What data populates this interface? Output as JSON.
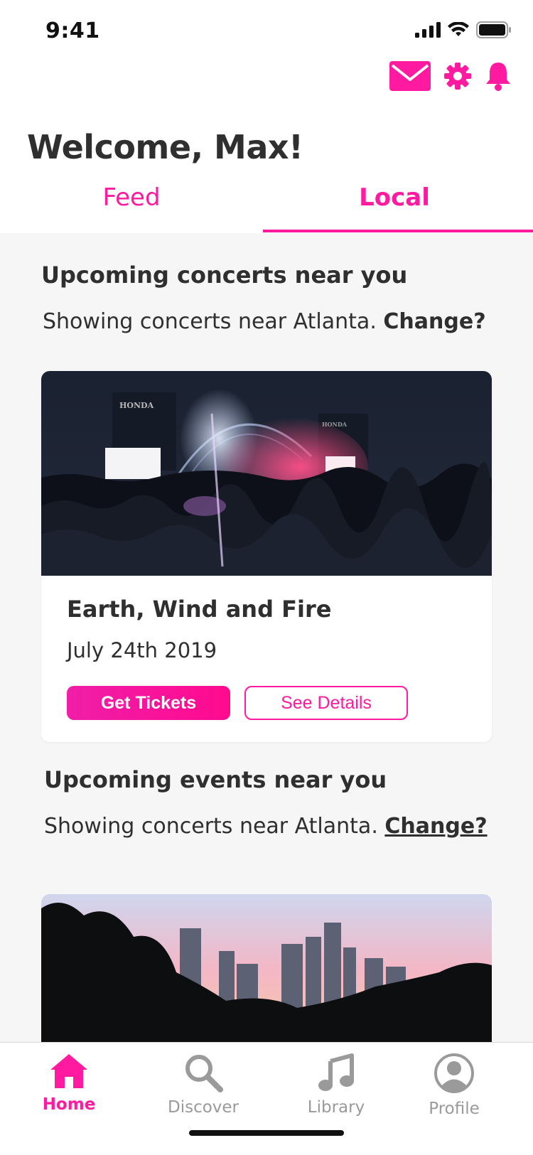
{
  "status_bar": {
    "time": "9:41"
  },
  "header": {
    "welcome": "Welcome, Max!"
  },
  "tabs": [
    {
      "label": "Feed",
      "active": false
    },
    {
      "label": "Local",
      "active": true
    }
  ],
  "sections": {
    "concerts": {
      "title": "Upcoming concerts near you",
      "subtitle_prefix": "Showing concerts near Atlanta. ",
      "change": "Change?"
    },
    "events": {
      "title": "Upcoming events near you",
      "subtitle_prefix": "Showing concerts near Atlanta. ",
      "change": "Change?"
    }
  },
  "concert_card": {
    "artist": "Earth, Wind and Fire",
    "date": "July 24th 2019",
    "primary_button": "Get Tickets",
    "secondary_button": "See Details",
    "image_brand_1": "HONDA",
    "image_brand_2": "HONDA"
  },
  "tab_bar": {
    "items": [
      {
        "label": "Home",
        "icon": "home-icon",
        "active": true
      },
      {
        "label": "Discover",
        "icon": "search-icon",
        "active": false
      },
      {
        "label": "Library",
        "icon": "music-note-icon",
        "active": false
      },
      {
        "label": "Profile",
        "icon": "profile-icon",
        "active": false
      }
    ]
  },
  "colors": {
    "accent": "#ff1aa0",
    "text": "#2f2f2f",
    "inactive": "#9a9a9a",
    "background": "#f6f6f7"
  }
}
